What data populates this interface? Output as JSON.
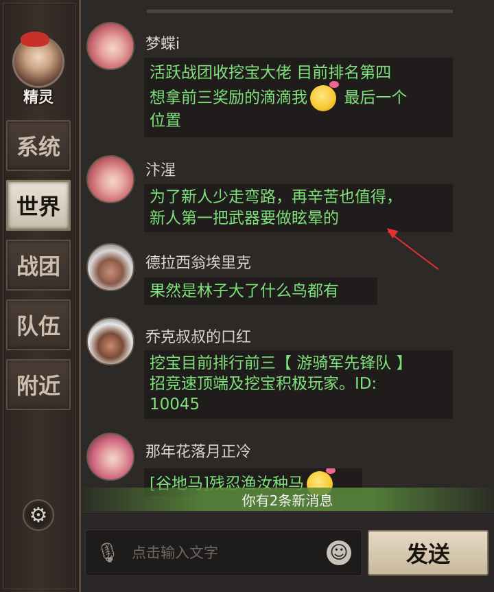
{
  "sidebar": {
    "avatar_label": "精灵",
    "tabs": [
      {
        "label": "系统",
        "active": false
      },
      {
        "label": "世界",
        "active": true
      },
      {
        "label": "战团",
        "active": false
      },
      {
        "label": "队伍",
        "active": false
      },
      {
        "label": "附近",
        "active": false
      }
    ],
    "settings_icon": "gear-icon"
  },
  "messages": [
    {
      "name": "梦蝶i",
      "lines": [
        "活跃战团收挖宝大佬 目前排名第四",
        "想拿前三奖励的滴滴我",
        "最后一个",
        "位置"
      ]
    },
    {
      "name": "汴湦",
      "lines": [
        "为了新人少走弯路，再辛苦也值得，",
        "新人第一把武器要做眩晕的"
      ]
    },
    {
      "name": "德拉西翁埃里克",
      "lines": [
        "果然是林子大了什么鸟都有"
      ]
    },
    {
      "name": "乔克叔叔的口红",
      "lines": [
        "挖宝目前排行前三【 游骑军先锋队 】",
        " 招竞速顶端及挖宝积极玩家。ID:",
        "10045"
      ]
    },
    {
      "name": "那年花落月正冷",
      "lines": [
        "[谷地马]残忍渔汝种马"
      ]
    }
  ],
  "notification": "你有2条新消息",
  "input": {
    "placeholder": "点击输入文字",
    "mic_icon": "microphone-icon",
    "emoji_icon": "smiley-icon"
  },
  "send_label": "发送",
  "colors": {
    "message_text": "#7ee07a",
    "annotation_arrow": "#e03030"
  }
}
